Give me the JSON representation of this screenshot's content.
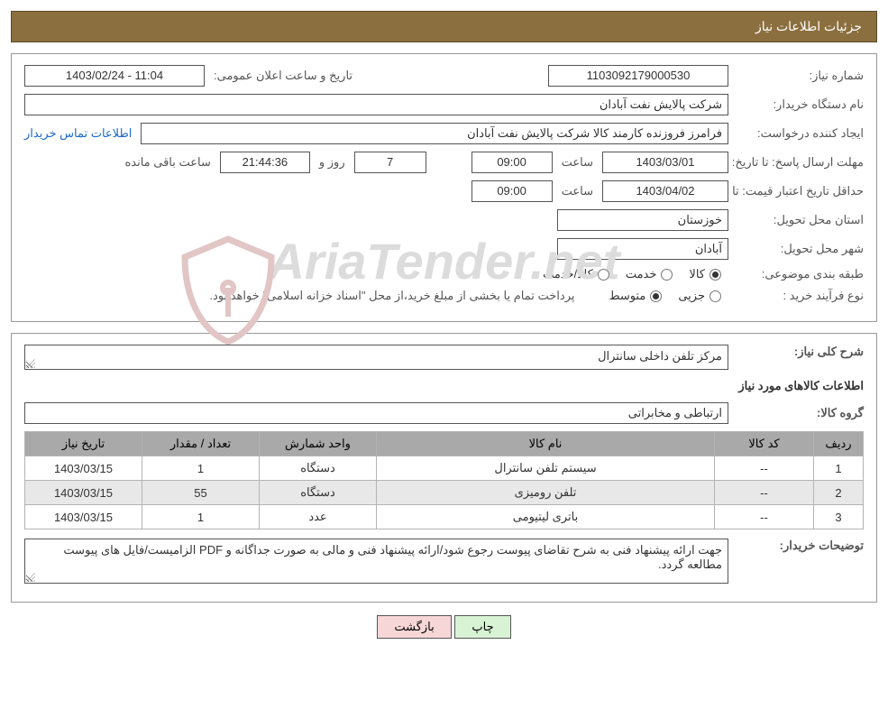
{
  "header": {
    "title": "جزئیات اطلاعات نیاز"
  },
  "panel1": {
    "need_no_label": "شماره نیاز:",
    "need_no": "1103092179000530",
    "announce_label": "تاریخ و ساعت اعلان عمومی:",
    "announce_value": "1403/02/24 - 11:04",
    "buyer_label": "نام دستگاه خریدار:",
    "buyer_value": "شرکت پالایش نفت آبادان",
    "creator_label": "ایجاد کننده درخواست:",
    "creator_value": "فرامرز فروزنده کارمند کالا شرکت پالایش نفت آبادان",
    "contact_link": "اطلاعات تماس خریدار",
    "deadline_label": "مهلت ارسال پاسخ:",
    "until_date_label": "تا تاریخ:",
    "deadline_date": "1403/03/01",
    "hour_label": "ساعت",
    "deadline_hour": "09:00",
    "days_label": "روز و",
    "days_value": "7",
    "remain_time": "21:44:36",
    "remain_suffix": "ساعت باقی مانده",
    "validity_label": "حداقل تاریخ اعتبار قیمت:",
    "validity_date": "1403/04/02",
    "validity_hour": "09:00",
    "province_label": "استان محل تحویل:",
    "province_value": "خوزستان",
    "city_label": "شهر محل تحویل:",
    "city_value": "آبادان",
    "class_label": "طبقه بندی موضوعی:",
    "class_opts": {
      "goods": "کالا",
      "service": "خدمت",
      "both": "کالا/خدمت"
    },
    "process_label": "نوع فرآیند خرید :",
    "process_opts": {
      "minor": "جزیی",
      "medium": "متوسط"
    },
    "process_note": "پرداخت تمام یا بخشی از مبلغ خرید،از محل \"اسناد خزانه اسلامی\" خواهد بود."
  },
  "panel2": {
    "desc_label": "شرح کلی نیاز:",
    "desc_value": "مرکز تلفن داخلی سانترال",
    "goods_info_title": "اطلاعات کالاهای مورد نیاز",
    "group_label": "گروه کالا:",
    "group_value": "ارتباطی و مخابراتی",
    "thead": [
      "ردیف",
      "کد کالا",
      "نام کالا",
      "واحد شمارش",
      "تعداد / مقدار",
      "تاریخ نیاز"
    ],
    "rows": [
      {
        "idx": "1",
        "code": "--",
        "name": "سیستم تلفن سانترال",
        "unit": "دستگاه",
        "qty": "1",
        "date": "1403/03/15"
      },
      {
        "idx": "2",
        "code": "--",
        "name": "تلفن رومیزی",
        "unit": "دستگاه",
        "qty": "55",
        "date": "1403/03/15"
      },
      {
        "idx": "3",
        "code": "--",
        "name": "باتری لیتیومی",
        "unit": "عدد",
        "qty": "1",
        "date": "1403/03/15"
      }
    ],
    "buyer_notes_label": "توضیحات خریدار:",
    "buyer_notes_value": "جهت ارائه پیشنهاد فنی به شرح تقاضای پیوست رجوع شود/ارائه پیشنهاد فنی و مالی به صورت جداگانه و PDF الزامیست/فایل های پیوست مطالعه گردد."
  },
  "footer": {
    "print": "چاپ",
    "back": "بازگشت"
  },
  "watermark": "AriaTender.net"
}
